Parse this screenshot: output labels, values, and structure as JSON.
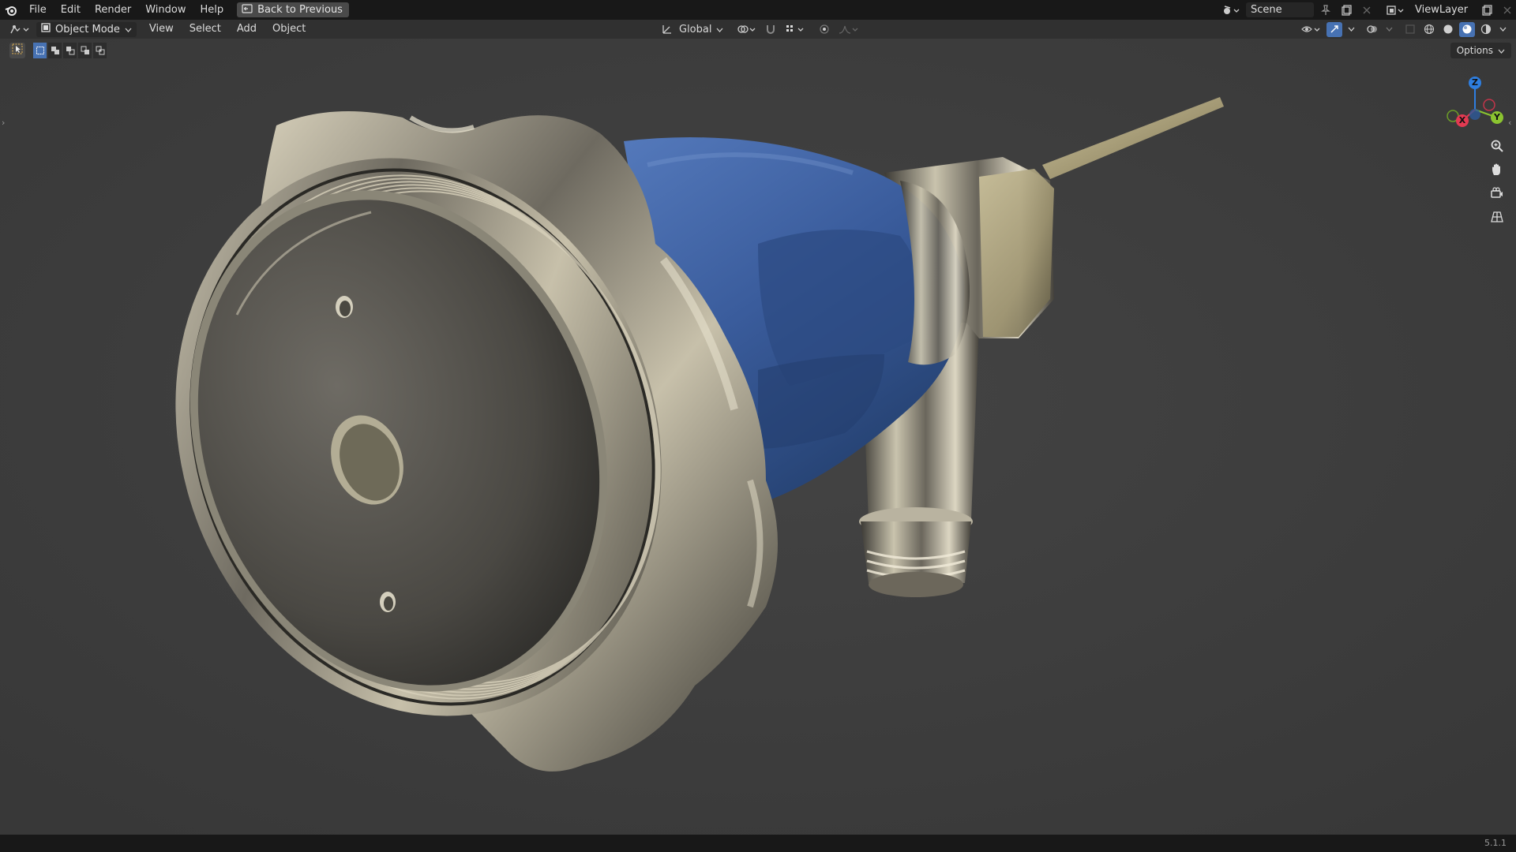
{
  "topbar": {
    "menus": [
      "File",
      "Edit",
      "Render",
      "Window",
      "Help"
    ],
    "back_label": "Back to Previous",
    "scene_name": "Scene",
    "view_layer": "ViewLayer"
  },
  "header": {
    "mode": "Object Mode",
    "menus": [
      "View",
      "Select",
      "Add",
      "Object"
    ],
    "transform_orientation": "Global"
  },
  "toolbar": {
    "options_label": "Options"
  },
  "gizmo": {
    "x": "X",
    "y": "Y",
    "z": "Z"
  },
  "status": {
    "version": "5.1.1"
  },
  "colors": {
    "accent": "#4772b3",
    "viewport_bg": "#3c3c3c",
    "handle_blue": "#3d5f9e"
  }
}
